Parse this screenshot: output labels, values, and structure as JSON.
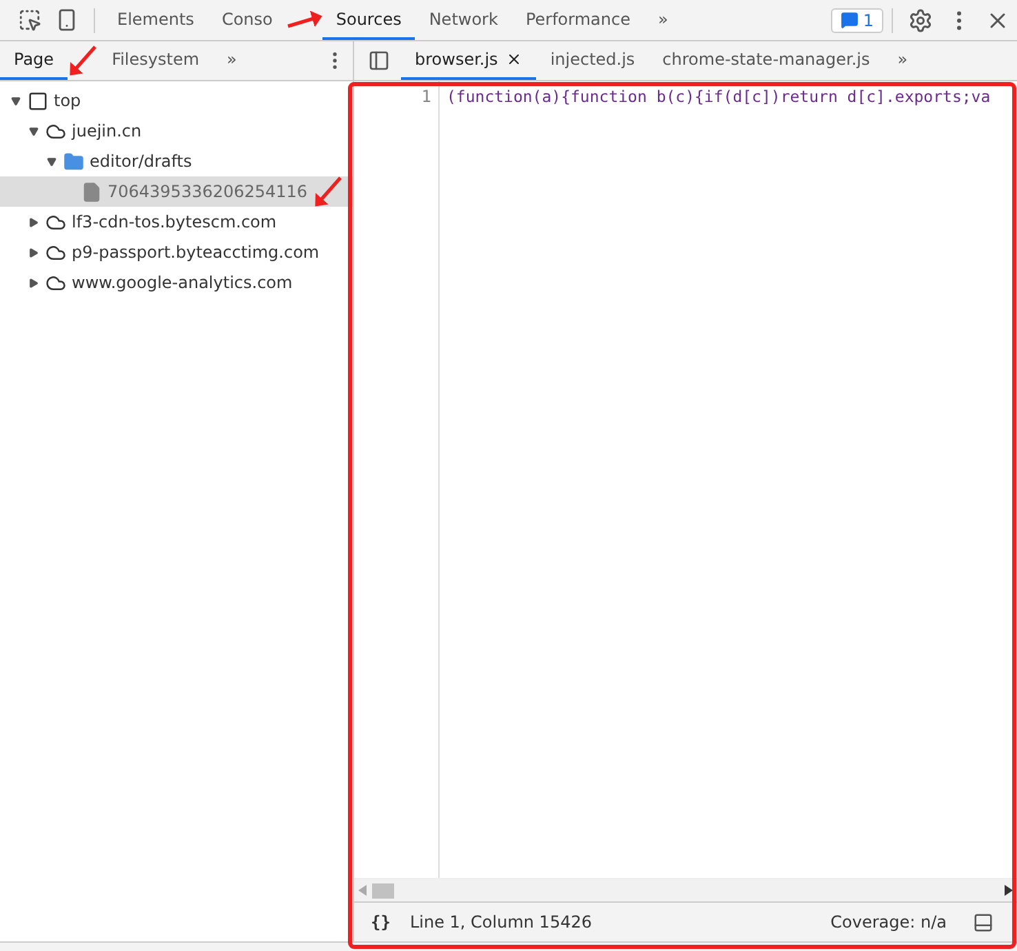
{
  "main_tabs": [
    {
      "label": "Elements",
      "selected": false,
      "annotated": false
    },
    {
      "label": "Conso",
      "selected": false,
      "annotated": false
    },
    {
      "label": "Sources",
      "selected": true,
      "annotated": true
    },
    {
      "label": "Network",
      "selected": false,
      "annotated": false
    },
    {
      "label": "Performance",
      "selected": false,
      "annotated": false
    }
  ],
  "more_tabs": "»",
  "issues_badge": "1",
  "navigator": {
    "tabs": [
      {
        "label": "Page",
        "selected": true,
        "annotated": true
      },
      {
        "label": "Filesystem",
        "selected": false,
        "annotated": false
      }
    ],
    "more": "»",
    "tree": [
      {
        "label": "top",
        "kind": "frame",
        "expanded": true,
        "selected": false,
        "children": [
          {
            "label": "juejin.cn",
            "kind": "domain",
            "expanded": true,
            "selected": false,
            "children": [
              {
                "label": "editor/drafts",
                "kind": "folder",
                "expanded": true,
                "selected": false,
                "children": [
                  {
                    "label": "7064395336206254116",
                    "kind": "file",
                    "selected": true,
                    "annotated": true
                  }
                ]
              }
            ]
          },
          {
            "label": "lf3-cdn-tos.bytescm.com",
            "kind": "domain",
            "expanded": false,
            "selected": false
          },
          {
            "label": "p9-passport.byteacctimg.com",
            "kind": "domain",
            "expanded": false,
            "selected": false
          },
          {
            "label": "www.google-analytics.com",
            "kind": "domain",
            "expanded": false,
            "selected": false
          }
        ]
      }
    ]
  },
  "editor": {
    "annotated": true,
    "tabs": [
      {
        "label": "browser.js",
        "selected": true,
        "closable": true
      },
      {
        "label": "injected.js",
        "selected": false,
        "closable": false
      },
      {
        "label": "chrome-state-manager.js",
        "selected": false,
        "closable": false
      }
    ],
    "more": "»",
    "lines": [
      {
        "number": "1",
        "code": "(function(a){function b(c){if(d[c])return d[c].exports;va"
      }
    ],
    "status": {
      "format": "{}",
      "position": "Line 1, Column 15426",
      "coverage": "Coverage: n/a"
    }
  }
}
